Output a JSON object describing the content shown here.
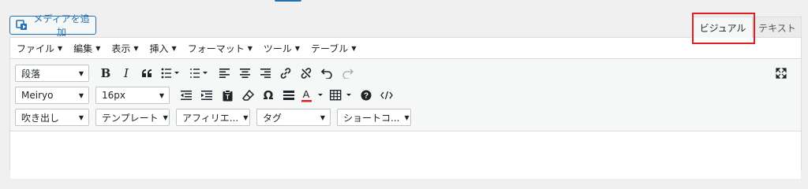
{
  "media_button": {
    "label": "メディアを追加",
    "icon": "media-icon"
  },
  "tabs": {
    "visual": "ビジュアル",
    "text": "テキスト",
    "active": "visual"
  },
  "menubar": [
    {
      "label": "ファイル"
    },
    {
      "label": "編集"
    },
    {
      "label": "表示"
    },
    {
      "label": "挿入"
    },
    {
      "label": "フォーマット"
    },
    {
      "label": "ツール"
    },
    {
      "label": "テーブル"
    }
  ],
  "toolbar": {
    "row1": {
      "format_select": "段落",
      "buttons": [
        "bold-icon",
        "italic-icon",
        "blockquote-icon",
        "bullet-list-icon",
        "numbered-list-icon",
        "align-left-icon",
        "align-center-icon",
        "align-right-icon",
        "link-icon",
        "unlink-icon",
        "undo-icon",
        "redo-icon"
      ]
    },
    "row2": {
      "font_family": "Meiryo",
      "font_size": "16px",
      "buttons": [
        "outdent-icon",
        "indent-icon",
        "paste-text-icon",
        "eraser-icon",
        "omega-icon",
        "horizontal-rule-icon",
        "text-color-icon",
        "table-icon",
        "help-icon",
        "code-icon"
      ]
    },
    "row3": {
      "selects": [
        "吹き出し",
        "テンプレート",
        "アフィリエ...",
        "タグ",
        "ショートコ..."
      ]
    }
  },
  "colors": {
    "accent": "#2271b1",
    "highlight": "#e02020",
    "text_color_bar": "#e02020"
  }
}
